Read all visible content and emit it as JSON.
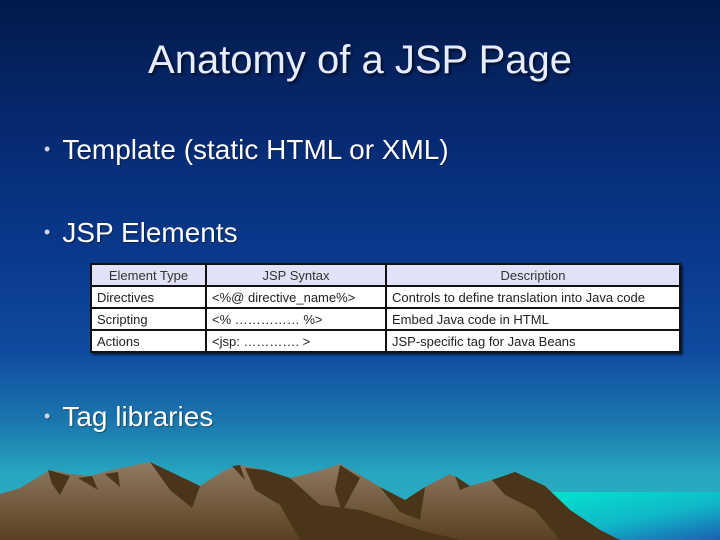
{
  "slide": {
    "title": "Anatomy of a JSP Page",
    "bullets": [
      {
        "symbol": "•",
        "text": "Template (static HTML or XML)"
      },
      {
        "symbol": "•",
        "text": "JSP Elements"
      },
      {
        "symbol": "•",
        "text": "Tag libraries"
      }
    ],
    "table": {
      "headers": [
        "Element Type",
        "JSP Syntax",
        "Description"
      ],
      "rows": [
        [
          "Directives",
          "<%@ directive_name%>",
          "Controls to define translation into Java code"
        ],
        [
          "Scripting",
          "<% …………… %>",
          "Embed Java code in HTML"
        ],
        [
          "Actions",
          "<jsp: …………. >",
          "JSP-specific tag for Java Beans"
        ]
      ]
    },
    "background": {
      "sky_top": "#021a4a",
      "sky_bottom": "#2bb2c2",
      "sea": "#00f0d0",
      "mountain_light": "#8a7560",
      "mountain_dark": "#4a3518"
    }
  }
}
